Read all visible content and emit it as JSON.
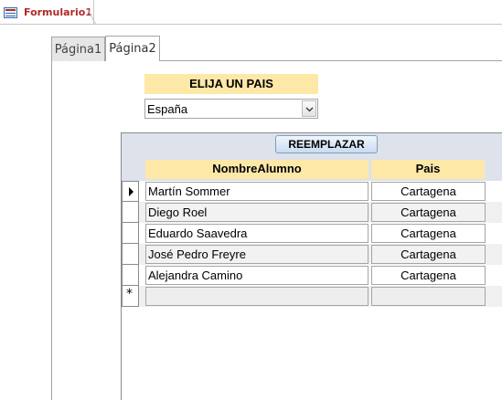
{
  "document_tab": {
    "title": "Formulario1",
    "icon": "form-icon"
  },
  "page_tabs": [
    {
      "label": "Página1",
      "active": false
    },
    {
      "label": "Página2",
      "active": true
    }
  ],
  "country_section": {
    "label": "ELIJA UN PAIS",
    "selected_value": "España",
    "dropdown_icon": "chevron-down-icon"
  },
  "subform": {
    "replace_button_label": "REEMPLAZAR",
    "columns": [
      "NombreAlumno",
      "Pais"
    ],
    "rows": [
      {
        "name": "Martín Sommer",
        "country": "Cartagena"
      },
      {
        "name": "Diego Roel",
        "country": "Cartagena"
      },
      {
        "name": "Eduardo Saavedra",
        "country": "Cartagena"
      },
      {
        "name": "José Pedro Freyre",
        "country": "Cartagena"
      },
      {
        "name": "Alejandra Camino",
        "country": "Cartagena"
      }
    ],
    "new_record_marker": "*",
    "current_record_icon": "record-pointer-icon"
  },
  "colors": {
    "header_accent": "#fde8a8",
    "subform_header": "#dde2eb",
    "doc_title": "#b02a2a"
  }
}
